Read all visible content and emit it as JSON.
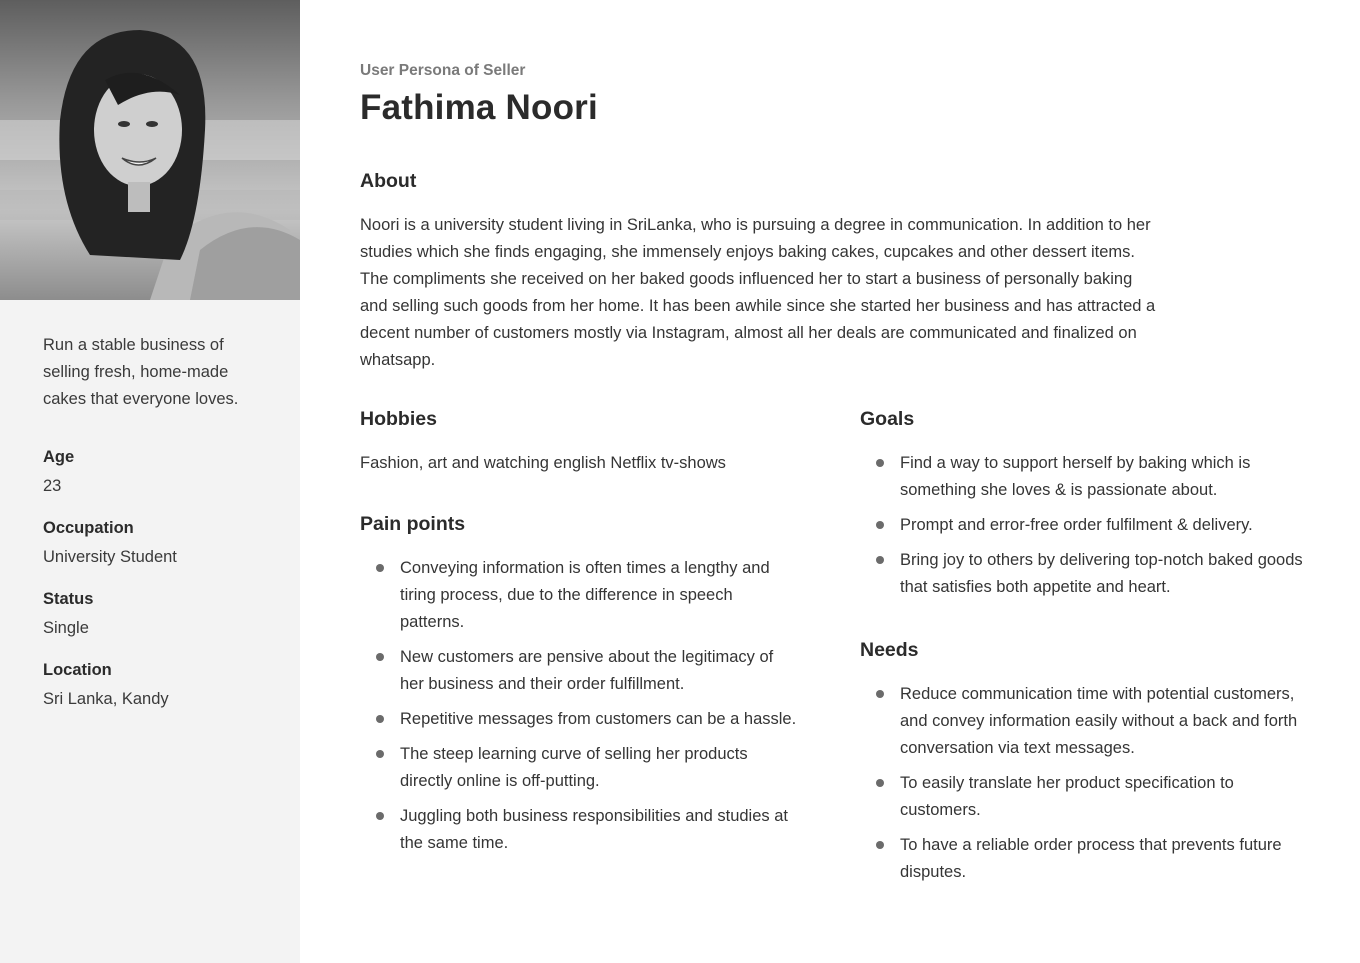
{
  "eyebrow": "User Persona of Seller",
  "name": "Fathima Noori",
  "sidebar": {
    "tagline": "Run a stable business of selling fresh, home-made cakes that everyone loves.",
    "facts": [
      {
        "label": "Age",
        "value": "23"
      },
      {
        "label": "Occupation",
        "value": "University Student"
      },
      {
        "label": "Status",
        "value": "Single"
      },
      {
        "label": "Location",
        "value": "Sri Lanka, Kandy"
      }
    ]
  },
  "about": {
    "title": "About",
    "text": "Noori is a university student living in SriLanka, who is pursuing a degree in communication. In addition to her studies which she finds engaging, she immensely enjoys baking cakes, cupcakes and other dessert items. The compliments she received on her baked goods influenced her to start a business of personally baking and selling such goods from her home. It has been awhile since she started her business and has attracted a decent number of customers mostly via Instagram, almost all her deals are communicated and finalized on whatsapp."
  },
  "hobbies": {
    "title": "Hobbies",
    "text": "Fashion, art and watching english Netflix tv-shows"
  },
  "pain_points": {
    "title": "Pain points",
    "items": [
      "Conveying information is often times a lengthy and tiring process, due to the difference in speech patterns.",
      "New customers are pensive about the legitimacy of her business and their order fulfillment.",
      "Repetitive messages from customers can be a hassle.",
      "The steep learning curve of selling her products directly online is off-putting.",
      "Juggling both business responsibilities and studies at the same time."
    ]
  },
  "goals": {
    "title": "Goals",
    "items": [
      "Find a way to support herself by baking which is something she loves & is passionate about.",
      "Prompt and error-free order fulfilment & delivery.",
      "Bring joy to others by delivering top-notch baked goods that satisfies both appetite and heart."
    ]
  },
  "needs": {
    "title": "Needs",
    "items": [
      "Reduce communication time with potential customers, and convey information easily without a back and forth conversation via text messages.",
      "To easily translate her product specification to customers.",
      "To have a reliable order process that prevents future disputes."
    ]
  }
}
